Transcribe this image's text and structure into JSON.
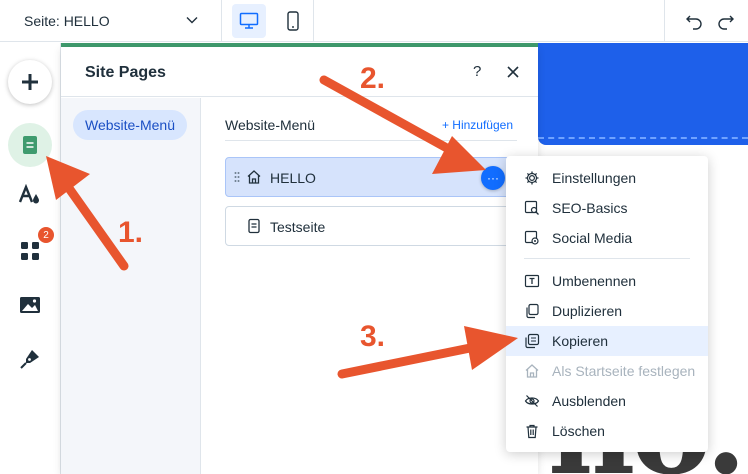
{
  "topbar": {
    "page_select_label": "Seite: HELLO",
    "device_desktop_icon": "desktop-icon",
    "device_mobile_icon": "mobile-icon",
    "undo_icon": "undo-icon",
    "redo_icon": "redo-icon"
  },
  "left_toolbar": {
    "items": [
      {
        "name": "add",
        "icon": "plus-icon"
      },
      {
        "name": "pages",
        "icon": "page-icon"
      },
      {
        "name": "design",
        "icon": "font-drop-icon"
      },
      {
        "name": "apps",
        "icon": "apps-grid-icon"
      },
      {
        "name": "media",
        "icon": "image-icon"
      },
      {
        "name": "blog",
        "icon": "pen-icon"
      }
    ],
    "apps_badge": "2"
  },
  "panel": {
    "title": "Site Pages",
    "help": "?",
    "side_tab": "Website-Menü",
    "menu_title": "Website-Menü",
    "add_link": "+ Hinzufügen",
    "pages": [
      {
        "label": "HELLO",
        "icon": "home-icon",
        "selected": true
      },
      {
        "label": "Testseite",
        "icon": "page-icon",
        "selected": false
      }
    ],
    "more_label": "···"
  },
  "context_menu": {
    "items": [
      {
        "label": "Einstellungen",
        "icon": "gear-icon"
      },
      {
        "label": "SEO-Basics",
        "icon": "seo-icon"
      },
      {
        "label": "Social Media",
        "icon": "social-icon"
      },
      {
        "label": "Umbenennen",
        "icon": "rename-icon"
      },
      {
        "label": "Duplizieren",
        "icon": "duplicate-icon"
      },
      {
        "label": "Kopieren",
        "icon": "copy-icon"
      },
      {
        "label": "Als Startseite festlegen",
        "icon": "home-icon"
      },
      {
        "label": "Ausblenden",
        "icon": "eye-hidden-icon"
      },
      {
        "label": "Löschen",
        "icon": "trash-icon"
      }
    ],
    "highlighted": "Kopieren",
    "disabled": "Als Startseite festlegen"
  },
  "annotations": [
    "1.",
    "2.",
    "3."
  ],
  "canvas": {
    "big_text": "no."
  },
  "colors": {
    "accent": "#116dff",
    "annotation": "#e8552e",
    "band": "#1e60ea",
    "pages_active": "#dff2e6"
  }
}
